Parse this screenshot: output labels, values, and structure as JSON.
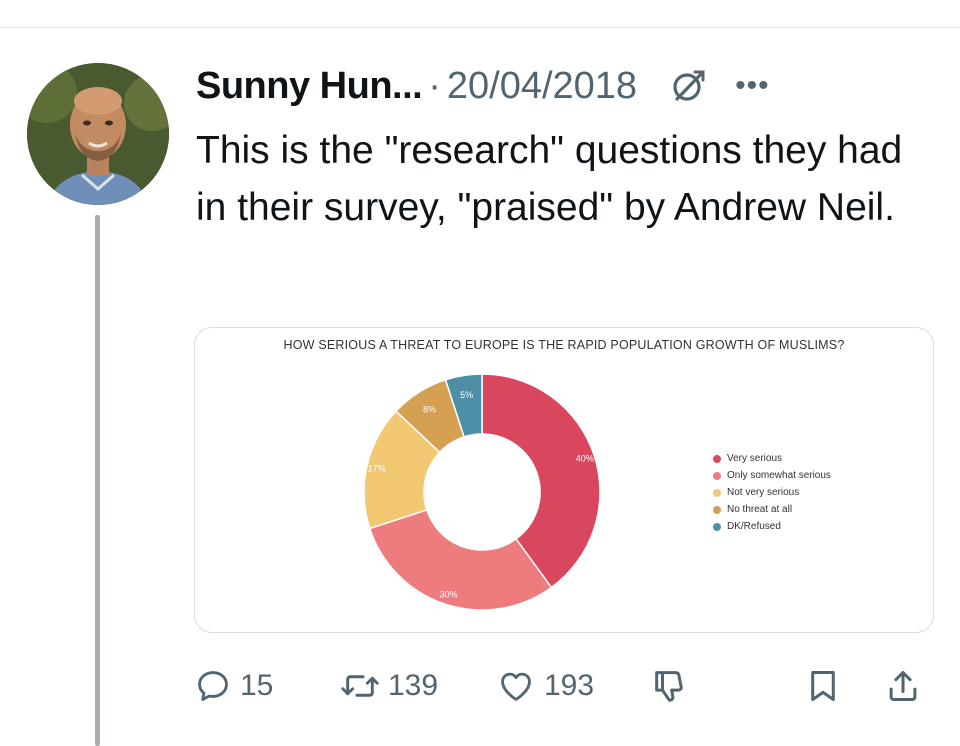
{
  "tweet": {
    "author_name": "Sunny Hun...",
    "separator": "·",
    "date": "20/04/2018",
    "more_label": "•••",
    "text": "This is the \"research\" questions they had in their survey, \"praised\" by Andrew Neil."
  },
  "icons": {
    "grok": "grok-icon",
    "more": "more-icon",
    "reply": "reply-icon",
    "retweet": "retweet-icon",
    "like": "heart-icon",
    "dislike": "thumbs-down-icon",
    "bookmark": "bookmark-icon",
    "share": "share-icon"
  },
  "actions": {
    "reply_count": "15",
    "retweet_count": "139",
    "like_count": "193"
  },
  "colors": {
    "very_serious": "#d9475f",
    "only_somewhat": "#ee7c7e",
    "not_very": "#f2c872",
    "no_threat": "#d6a052",
    "dk_refused": "#4e8fa8",
    "muted_text": "#536471"
  },
  "chart_data": {
    "type": "pie",
    "title": "HOW SERIOUS A THREAT TO EUROPE IS THE RAPID POPULATION GROWTH OF MUSLIMS?",
    "donut": true,
    "legend_position": "right",
    "categories": [
      "Very serious",
      "Only somewhat serious",
      "Not very serious",
      "No threat at all",
      "DK/Refused"
    ],
    "values": [
      40,
      30,
      17,
      8,
      5
    ],
    "labels": [
      "40%",
      "30%",
      "17%",
      "8%",
      "5%"
    ],
    "colors": [
      "#d9475f",
      "#ee7c7e",
      "#f2c872",
      "#d6a052",
      "#4e8fa8"
    ]
  }
}
